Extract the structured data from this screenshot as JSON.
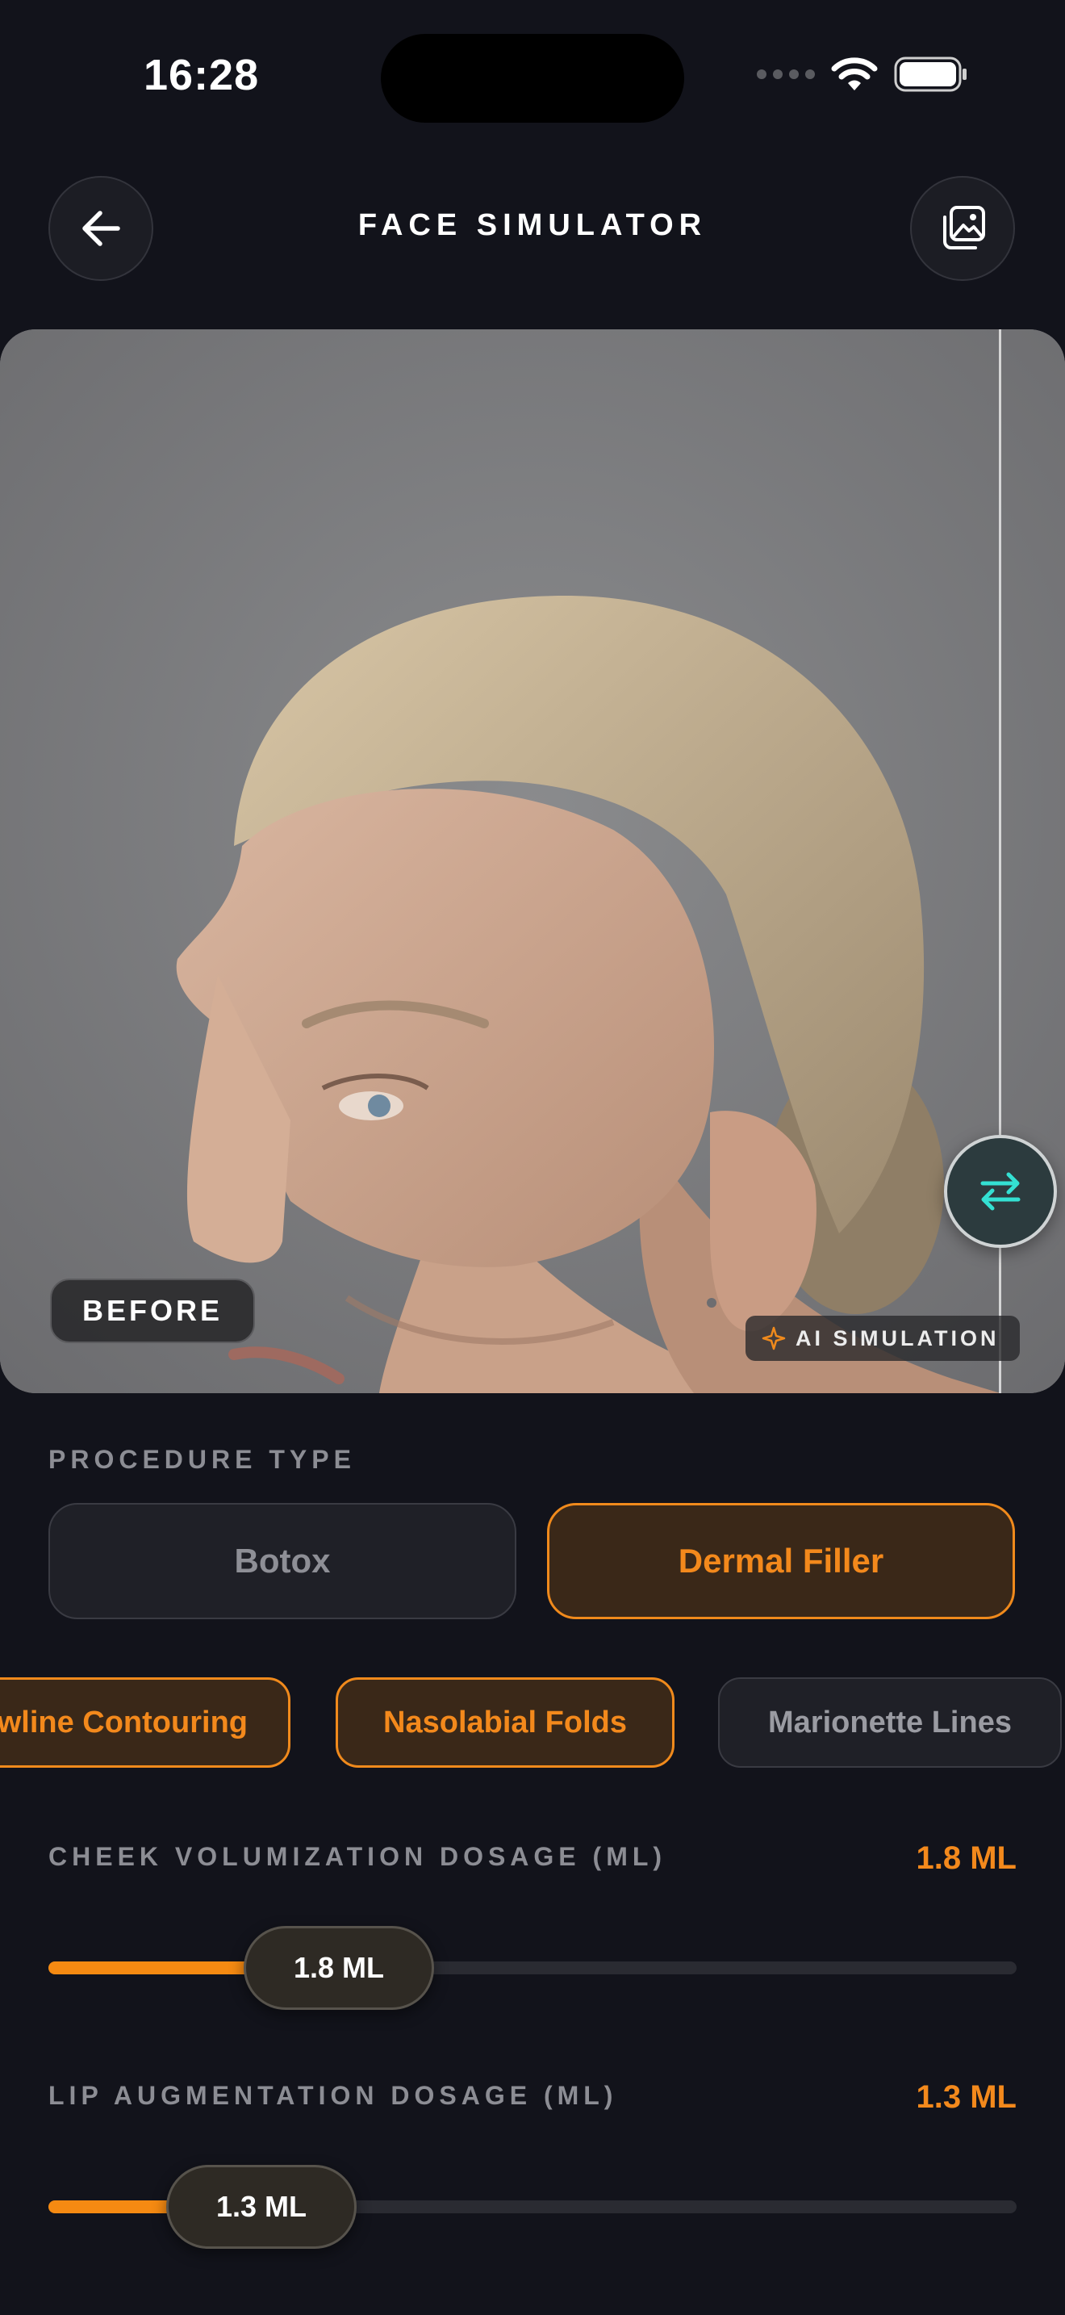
{
  "status": {
    "time": "16:28"
  },
  "header": {
    "title": "FACE SIMULATOR",
    "back_icon": "arrow-left-icon",
    "gallery_icon": "photo-gallery-icon"
  },
  "photo": {
    "before_label": "BEFORE",
    "ai_label": "AI SIMULATION",
    "compare_icon": "swap-arrows-icon",
    "accent_handle": "#34e0d2"
  },
  "procedure": {
    "label": "PROCEDURE TYPE",
    "options": [
      {
        "label": "Botox",
        "selected": false
      },
      {
        "label": "Dermal Filler",
        "selected": true
      }
    ]
  },
  "areas": [
    {
      "label": "Jawline Contouring",
      "selected": true
    },
    {
      "label": "Nasolabial Folds",
      "selected": true
    },
    {
      "label": "Marionette Lines",
      "selected": false
    }
  ],
  "sliders": [
    {
      "label": "CHEEK VOLUMIZATION DOSAGE (ML)",
      "value_text": "1.8 ML",
      "thumb_text": "1.8 ML",
      "fill_fraction": 0.3
    },
    {
      "label": "LIP AUGMENTATION DOSAGE (ML)",
      "value_text": "1.3 ML",
      "thumb_text": "1.3 ML",
      "fill_fraction": 0.22
    }
  ],
  "colors": {
    "accent": "#f3891c",
    "background": "#12131b"
  }
}
